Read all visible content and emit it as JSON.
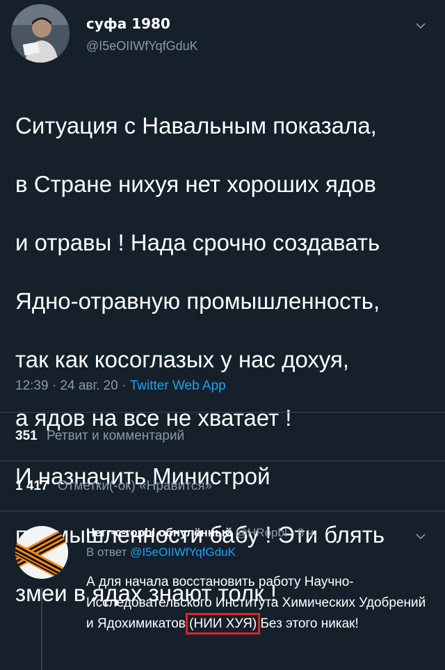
{
  "tweet": {
    "author_name": "суфа 1980",
    "author_handle": "@I5eOIIWfYqfGduK",
    "text_lines": [
      "Ситуация с Навальным показала,",
      "в Стране нихуя нет хороших ядов",
      "и отравы ! Нада срочно создавать",
      "Ядно-отравную промышленность,",
      "так как косоглазых у нас дохуя,",
      "а ядов на все не хватает !",
      "И назначить Министрой",
      "промышленности бабу ! Эти блять",
      "змеи в ядах знают толк !"
    ],
    "time": "12:39",
    "date": "24 авг. 20",
    "sep": "·",
    "app": "Twitter Web App",
    "retweets_count": "351",
    "retweets_label": "Ретвит и комментарий",
    "likes_count": "1 417",
    "likes_label": "Отметки(-ок) «Нравится»"
  },
  "reply": {
    "author_name": "Негг-с-ropbl обнулённый",
    "author_handle": "@HRopbl",
    "time_ago": "8 ч.",
    "reply_to_label": "В ответ",
    "reply_to_handle": "@I5eOIIWfYqfGduK",
    "text_before": "А для начала восстановить работу Научно-Исследовательского Института Химических Удобрений и Ядохимикатов",
    "text_highlight": "(НИИ ХУЯ)",
    "text_after": " Без этого никак!"
  },
  "colors": {
    "background": "#15202b",
    "muted": "#8899a6",
    "link": "#1da1f2",
    "highlight_box": "#e3212b",
    "divider": "#38444d"
  },
  "icons": [
    "chevron-down-icon",
    "avatar-photo",
    "st-george-ribbon-avatar"
  ]
}
